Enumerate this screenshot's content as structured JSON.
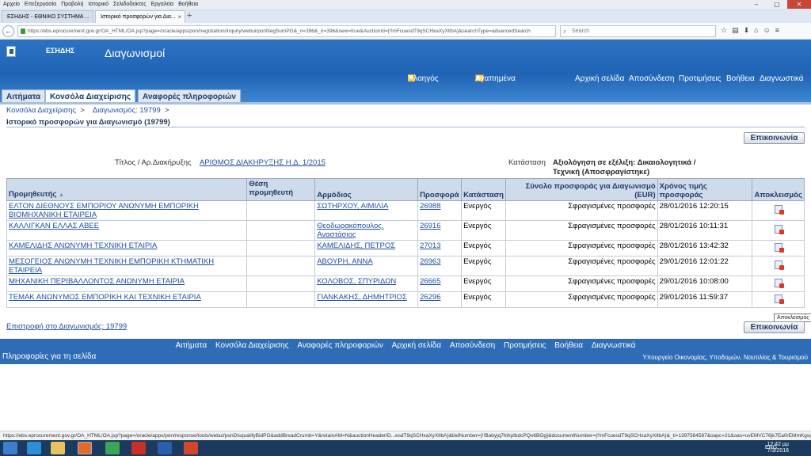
{
  "browser": {
    "menu": [
      "Αρχείο",
      "Επεξεργασία",
      "Προβολή",
      "Ιστορικό",
      "Σελιδοδείκτες",
      "Εργαλεία",
      "Βοήθεια"
    ],
    "tabs": [
      {
        "label": "ΕΣΗΔΗΣ - ΕΘΝΙΚΟ ΣΥΣΤΗΜΑ ..."
      },
      {
        "label": "Ιστορικό προσφορών για Δια..."
      }
    ],
    "url": "https://ebs.eprocurement.gov.gr/OA_HTML/OA.jsp?page=/oracle/apps/pon/negotiation/inquiry/webui/ponNegSumPG&_ri=396&_ri=396&new=true&AuctionId={!!mFcuesdT9qSCHxaXyXltbA}&searchType=advancedSearch",
    "search_placeholder": "Search",
    "status_url": "https://ebs.eprocurement.gov.gr/OA_HTML/OA.jsp?page=/oracle/apps/pon/response/tools/webui/ponDisqualifyBidPG&addBreadCrumb=Y&retainAM=N&auctionHeaderID...esdT9qSCHxaXyXltbA}&bidNumber={!!Babyjq7hihpIbdcPQn6BOg}&documentNumber={!!mFcuesdT9qSCHxaXyXltbA}&_ti=1397584587&oapc=21&oas=uvEMVC76jk7Ea0rEMmKgsg.."
  },
  "app": {
    "brand": "ΕΣΗΔΗΣ",
    "title": "Διαγωνισμοί",
    "nav": {
      "navigate": "Πλοηγός",
      "favorites": "Αγαπημένα",
      "home": "Αρχική σελίδα",
      "logout": "Αποσύνδεση",
      "preferences": "Προτιμήσεις",
      "help": "Βοήθεια",
      "diagnostics": "Διαγνωστικά"
    },
    "tabs": [
      "Αιτήματα",
      "Κονσόλα Διαχείρισης",
      "Αναφορές πληροφοριών"
    ]
  },
  "breadcrumb": {
    "item1": "Κονσόλα Διαχείρισης",
    "sep": ">",
    "item2": "Διαγωνισμός: 19799"
  },
  "page": {
    "title": "Ιστορικό προσφορών για Διαγωνισμό (19799)",
    "contact_button": "Επικοινωνία",
    "title_label": "Τίτλος / Αρ.Διακήρυξης",
    "title_value": "ΑΡΙΘΜΟΣ ΔΙΑΚΗΡΥΞΗΣ Η.Δ. 1/2015",
    "status_label": "Κατάσταση",
    "status_value": "Αξιολόγηση σε εξέλιξη: Δικαιολογητικά / Τεχνική (Αποσφραγίστηκε)",
    "return_link": "Επιστροφή στο Διαγωνισμός: 19799",
    "tooltip": "Αποκλεισμός"
  },
  "table": {
    "headers": {
      "supplier": "Προμηθευτής",
      "supplier_site": "Θέση προμηθευτή",
      "responsible": "Αρμόδιος",
      "bid": "Προσφορά",
      "status": "Κατάσταση",
      "total": "Σύνολο προσφοράς για Διαγωνισμό (EUR)",
      "time": "Χρόνος τιμής προσφοράς",
      "disqualify": "Αποκλεισμός"
    },
    "rows": [
      {
        "supplier": "ΕΛΤΟΝ ΔΙΕΘΝΟΥΣ ΕΜΠΟΡΙΟΥ ΑΝΩΝΥΜΗ ΕΜΠΟΡΙΚΗ ΒΙΟΜΗΧΑΝΙΚΗ ΕΤΑΙΡΕΙΑ",
        "site": "",
        "responsible": "ΣΩΤΗΡΧΟΥ, ΑΙΜΙΛΙΑ",
        "bid": "26988",
        "status": "Ενεργός",
        "total": "Σφραγισμένες προσφορές",
        "time": "28/01/2016 12:20:15"
      },
      {
        "supplier": "ΚΑΛΛΙΓΚΑΝ ΕΛΛΑΣ ΑΒΕΕ",
        "site": "",
        "responsible": "Θεοδωρακόπουλος, Αναστάσιος",
        "bid": "26916",
        "status": "Ενεργός",
        "total": "Σφραγισμένες προσφορές",
        "time": "28/01/2016 10:11:31"
      },
      {
        "supplier": "ΚΑΜΕΛΙΔΗΣ ΑΝΩΝΥΜΗ ΤΕΧΝΙΚΗ ΕΤΑΙΡΙΑ",
        "site": "",
        "responsible": "ΚΑΜΕΛΙΔΗΣ, ΠΕΤΡΟΣ",
        "bid": "27013",
        "status": "Ενεργός",
        "total": "Σφραγισμένες προσφορές",
        "time": "28/01/2016 13:42:32"
      },
      {
        "supplier": "ΜΕΣΟΓΕΙΟΣ ΑΝΩΝΥΜΗ ΤΕΧΝΙΚΗ ΕΜΠΟΡΙΚΗ ΚΤΗΜΑΤΙΚΗ ΕΤΑΙΡΕΙΑ",
        "site": "",
        "responsible": "ΑΒΟΥΡΗ, ΑΝΝΑ",
        "bid": "26963",
        "status": "Ενεργός",
        "total": "Σφραγισμένες προσφορές",
        "time": "29/01/2016 12:01:22"
      },
      {
        "supplier": "ΜΗΧΑΝΙΚΗ ΠΕΡΙΒΑΛΛΟΝΤΟΣ ΑΝΩΝΥΜΗ ΕΤΑΙΡΙΑ",
        "site": "",
        "responsible": "ΚΟΛΟΒΟΣ, ΣΠΥΡΙΔΩΝ",
        "bid": "26665",
        "status": "Ενεργός",
        "total": "Σφραγισμένες προσφορές",
        "time": "29/01/2016 10:08:00"
      },
      {
        "supplier": "ΤΕΜΑΚ ΑΝΩΝΥΜΟΣ ΕΜΠΟΡΙΚΗ ΚΑΙ ΤΕΧΝΙΚΗ ΕΤΑΙΡΙΑ",
        "site": "",
        "responsible": "ΓΙΑΝΚΑΚΗΣ, ΔΗΜΗΤΡΙΟΣ",
        "bid": "26296",
        "status": "Ενεργός",
        "total": "Σφραγισμένες προσφορές",
        "time": "29/01/2016 11:59:37"
      }
    ]
  },
  "footer": {
    "links": [
      "Αιτήματα",
      "Κονσόλα Διαχείρισης",
      "Αναφορές πληροφοριών",
      "Αρχική σελίδα",
      "Αποσύνδεση",
      "Προτιμήσεις",
      "Βοήθεια",
      "Διαγνωστικά"
    ],
    "info": "Πληροφορίες για τη σελίδα",
    "ministry": "Υπουργείο Οικονομίας, Υποδομών, Ναυτιλίας & Τουρισμού"
  },
  "taskbar": {
    "lang": "ENG",
    "time": "12:42 μμ",
    "date": "7/3/2016"
  },
  "colors": {
    "header_blue": "#1f63b5",
    "link_blue": "#1f4fa0",
    "table_header": "#cfdaea",
    "close_red": "#c7463a"
  }
}
